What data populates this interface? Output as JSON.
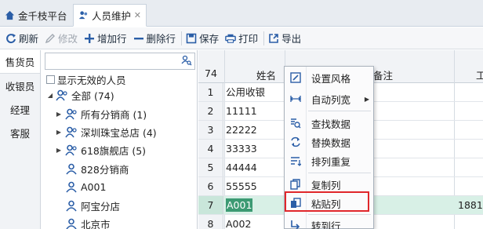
{
  "tabs": [
    {
      "label": "金千枝平台"
    },
    {
      "label": "人员维护",
      "close": "✕"
    }
  ],
  "toolbar": {
    "refresh": "刷新",
    "edit": "修改",
    "add_row": "增加行",
    "delete_row": "删除行",
    "save": "保存",
    "print": "打印",
    "export": "导出"
  },
  "left_tabs": [
    "售货员",
    "收银员",
    "经理",
    "客服"
  ],
  "search": {
    "value": "",
    "placeholder": ""
  },
  "show_invalid_label": "显示无效的人员",
  "tree": [
    {
      "label": "全部 (74)",
      "expanded": true
    },
    {
      "label": "所有分销商 (1)",
      "expandable": true
    },
    {
      "label": "深圳珠宝总店 (4)",
      "expandable": true
    },
    {
      "label": "618旗舰店 (5)",
      "expandable": true
    },
    {
      "label": "828分销商"
    },
    {
      "label": "A001"
    },
    {
      "label": "阿宝分店"
    },
    {
      "label": "北京市"
    }
  ],
  "grid": {
    "row_count": "74",
    "col_name": "姓名",
    "col_remark": "备注",
    "col_last": "工",
    "rows": [
      {
        "n": "1",
        "name": "公用收银"
      },
      {
        "n": "2",
        "name": "11111"
      },
      {
        "n": "3",
        "name": "22222"
      },
      {
        "n": "4",
        "name": "33333"
      },
      {
        "n": "5",
        "name": "44444"
      },
      {
        "n": "6",
        "name": "55555"
      },
      {
        "n": "7",
        "name": "A001",
        "extra": "1881",
        "selected": true
      },
      {
        "n": "8",
        "name": "A002"
      }
    ]
  },
  "context_menu": {
    "items": [
      {
        "label": "设置风格",
        "icon": "style-icon"
      },
      {
        "label": "自动列宽",
        "icon": "autowidth-icon",
        "submenu": "▶"
      },
      {
        "label": "查找数据",
        "icon": "find-icon"
      },
      {
        "label": "替换数据",
        "icon": "replace-icon"
      },
      {
        "label": "排列重复",
        "icon": "sort-icon"
      },
      {
        "label": "复制列",
        "icon": "copy-icon"
      },
      {
        "label": "粘贴列",
        "icon": "paste-icon",
        "highlighted": true
      },
      {
        "label": "转到行",
        "icon": "goto-icon"
      }
    ]
  },
  "colors": {
    "accent": "#2b5ea7",
    "selection": "#3c9a73",
    "highlight_border": "#e0272b"
  }
}
